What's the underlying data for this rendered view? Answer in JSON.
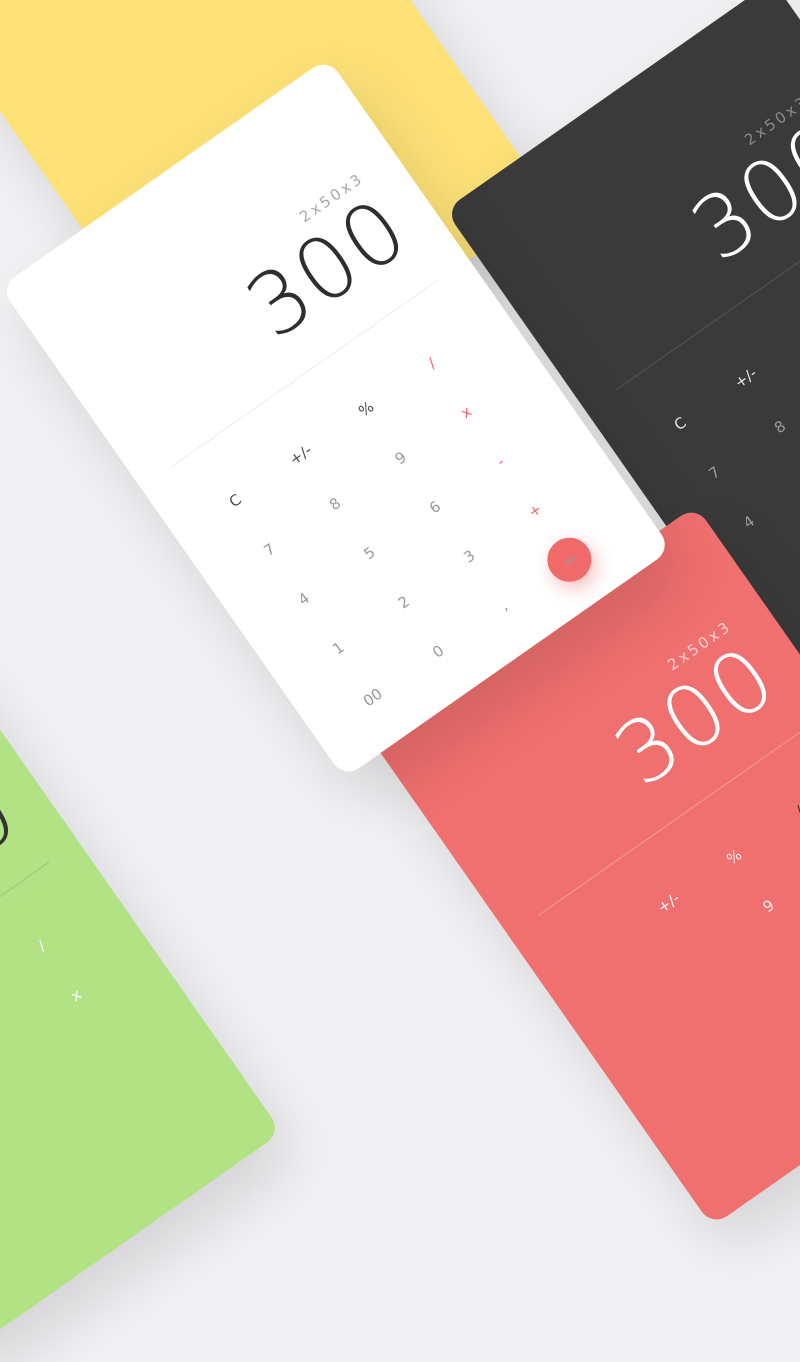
{
  "expression": "2x50x3",
  "result": "300",
  "keys": {
    "clear": "C",
    "plus_minus": "+/-",
    "percent": "%",
    "divide": "/",
    "multiply": "x",
    "subtract": "-",
    "add": "+",
    "equals": "=",
    "decimal": ",",
    "d0": "0",
    "d00": "00",
    "d1": "1",
    "d2": "2",
    "d3": "3",
    "d4": "4",
    "d5": "5",
    "d6": "6",
    "d7": "7",
    "d8": "8",
    "d9": "9"
  },
  "colors": {
    "background": "#f1f1f3",
    "white_card": "#ffffff",
    "dark_card": "#3a3a3a",
    "red_card": "#f06f6f",
    "green_card": "#b2e283",
    "yellow_card": "#fde177",
    "accent": "#f06a6a"
  }
}
